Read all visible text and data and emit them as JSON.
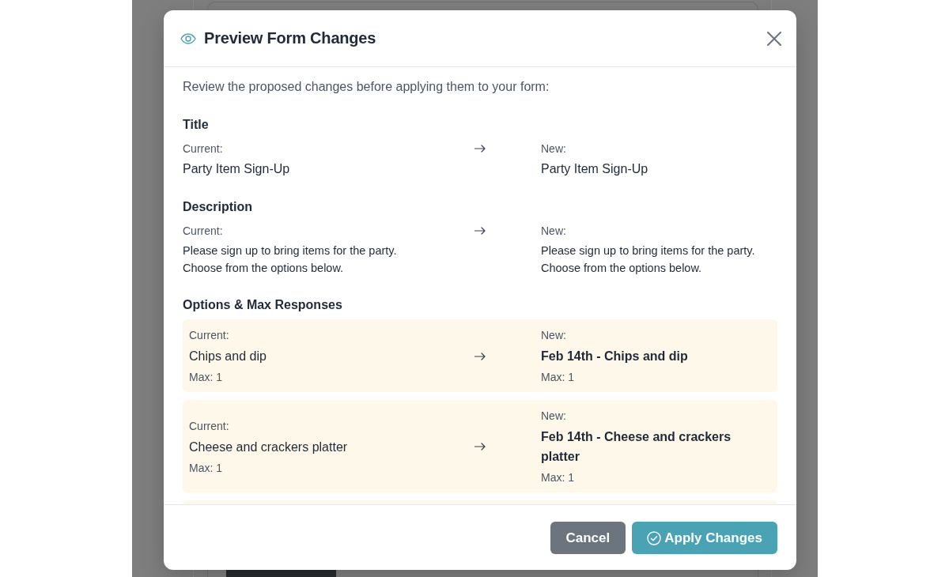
{
  "dialog": {
    "title": "Preview Form Changes",
    "intro": "Review the proposed changes before applying them to your form:"
  },
  "sections": [
    {
      "kind": "line",
      "heading": "Title",
      "change": {
        "current_label": "Current:",
        "current": "Party Item Sign-Up",
        "new_label": "New:",
        "new": "Party Item Sign-Up",
        "changed": false
      }
    },
    {
      "kind": "paragraph",
      "heading": "Description",
      "change": {
        "current_label": "Current:",
        "current": "Please sign up to bring items for the party.\nChoose from the options below.",
        "new_label": "New:",
        "new": "Please sign up to bring items for the party.\nChoose from the options below.",
        "changed": false
      }
    },
    {
      "kind": "options",
      "heading": "Options & Max Responses",
      "options": [
        {
          "current_label": "Current:",
          "current": "Chips and dip",
          "current_max": "Max: 1",
          "new_label": "New:",
          "new": "Feb 14th - Chips and dip",
          "new_max": "Max: 1",
          "changed": true
        },
        {
          "current_label": "Current:",
          "current": "Cheese and crackers platter",
          "current_max": "Max: 1",
          "new_label": "New:",
          "new": "Feb 14th - Cheese and crackers platter",
          "new_max": "Max: 1",
          "changed": true
        }
      ]
    }
  ],
  "buttons": [
    {
      "kind": "secondary",
      "label": "Cancel"
    },
    {
      "kind": "primary",
      "label": "Apply Changes"
    }
  ]
}
